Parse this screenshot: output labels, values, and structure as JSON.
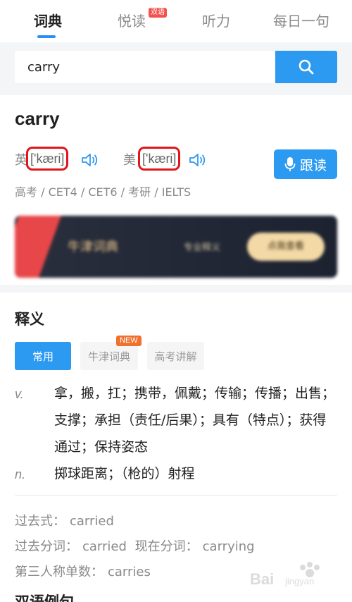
{
  "tabs": [
    {
      "label": "词典",
      "active": true
    },
    {
      "label": "悦读",
      "badge": "双语"
    },
    {
      "label": "听力"
    },
    {
      "label": "每日一句"
    }
  ],
  "search": {
    "value": "carry",
    "button_icon": "search-icon"
  },
  "word": "carry",
  "pronunciation": {
    "uk_label": "英",
    "uk_ipa": "['kæri]",
    "us_label": "美",
    "us_ipa": "['kæri]"
  },
  "follow_read_label": "跟读",
  "exam_tags": "高考 / CET4 / CET6 / 考研 / IELTS",
  "banner": {
    "text": "牛津词典",
    "sub": "专业释义",
    "cta": "点我查看"
  },
  "definitions": {
    "title": "释义",
    "chips": [
      "常用",
      "牛津词典",
      "高考讲解"
    ],
    "new_badge": "NEW",
    "entries": [
      {
        "pos": "v.",
        "text": "拿，搬，扛；携带，佩戴；传输；传播；出售；支撑；承担（责任/后果）；具有（特点）；获得通过；保持姿态"
      },
      {
        "pos": "n.",
        "text": "掷球距离；（枪的）射程"
      }
    ]
  },
  "word_forms": {
    "past_label": "过去式：",
    "past": "carried",
    "pp_label": "过去分词：",
    "pp": "carried",
    "presp_label": "现在分词：",
    "presp": "carrying",
    "third_label": "第三人称单数：",
    "third": "carries"
  },
  "next_section": "双语例句",
  "colors": {
    "accent": "#2d9af1",
    "highlight": "#e0161c",
    "badge": "#f2534e"
  }
}
